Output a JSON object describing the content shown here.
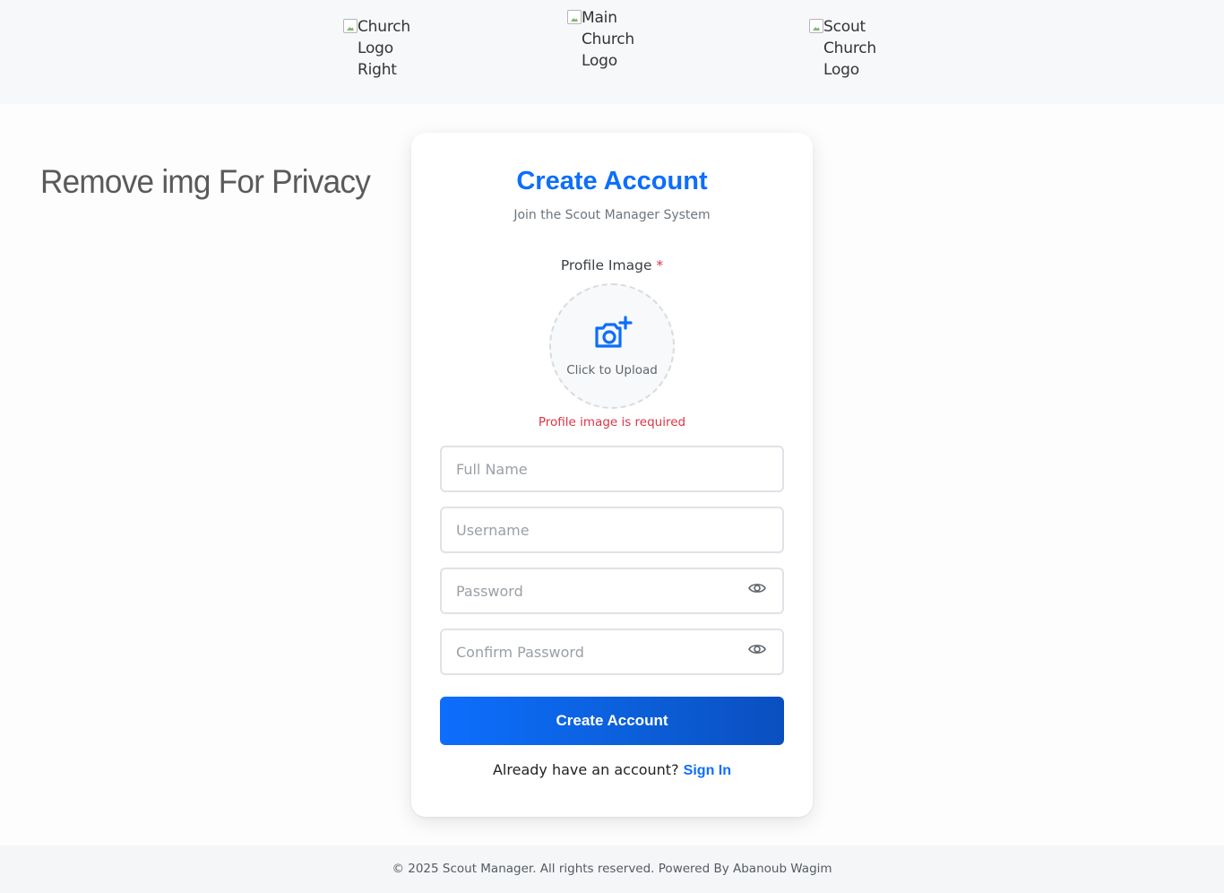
{
  "header": {
    "logo_left_alt": "Church Logo Right",
    "logo_main_alt": "Main Church Logo",
    "logo_right_alt": "Scout Church Logo"
  },
  "privacy_note": "Remove img For Privacy",
  "form": {
    "title": "Create Account",
    "subtitle": "Join the Scout Manager System",
    "profile_label": "Profile Image",
    "required_mark": "*",
    "upload_text": "Click to Upload",
    "upload_icon": "camera-plus-icon",
    "error": "Profile image is required",
    "full_name_placeholder": "Full Name",
    "username_placeholder": "Username",
    "password_placeholder": "Password",
    "confirm_placeholder": "Confirm Password",
    "eye_icon": "eye-icon",
    "submit_label": "Create Account",
    "signin_prompt": "Already have an account?",
    "signin_link": "Sign In"
  },
  "footer": {
    "text": "© 2025 Scout Manager. All rights reserved. Powered By Abanoub Wagim"
  },
  "colors": {
    "primary": "#0d6efd",
    "danger": "#dc3545"
  }
}
